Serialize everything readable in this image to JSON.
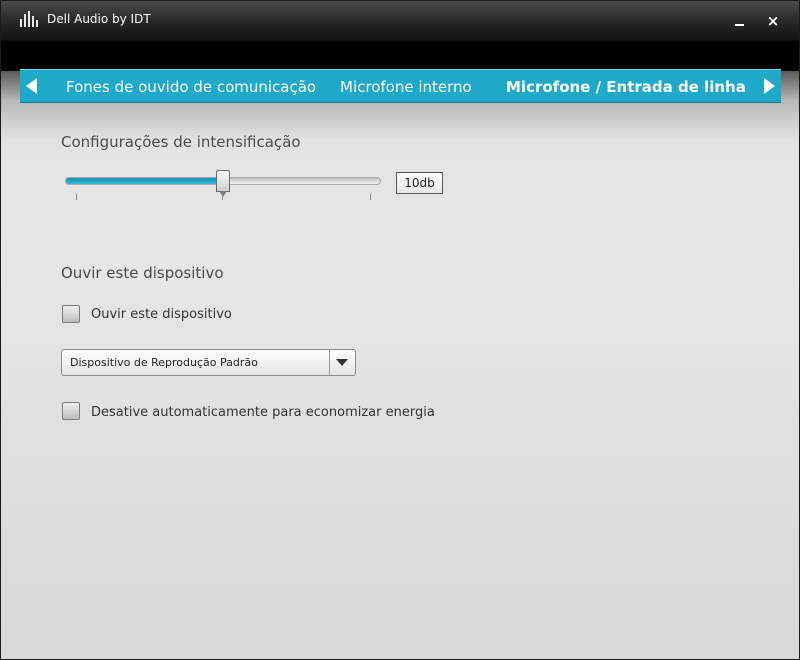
{
  "window": {
    "title": "Dell Audio by IDT",
    "minimize_label": "–",
    "close_label": "×"
  },
  "tabs": [
    {
      "label": "Fones de ouvido de comunicação",
      "active": false
    },
    {
      "label": "Microfone interno",
      "active": false
    },
    {
      "label": "Microfone / Entrada de linha",
      "active": true
    }
  ],
  "boost": {
    "heading": "Configurações de intensificação",
    "value_label": "10db",
    "level": 0.5
  },
  "listen": {
    "heading": "Ouvir este dispositivo",
    "checkbox_label": "Ouvir este dispositivo",
    "checked": false,
    "playback_device": "Dispositivo de Reprodução Padrão",
    "auto_disable_label": "Desative automaticamente para economizar energia",
    "auto_disable_checked": false
  },
  "colors": {
    "accent": "#1ea9c9",
    "titlebar": "#2b2b2b",
    "background": "#dcdcdc"
  }
}
